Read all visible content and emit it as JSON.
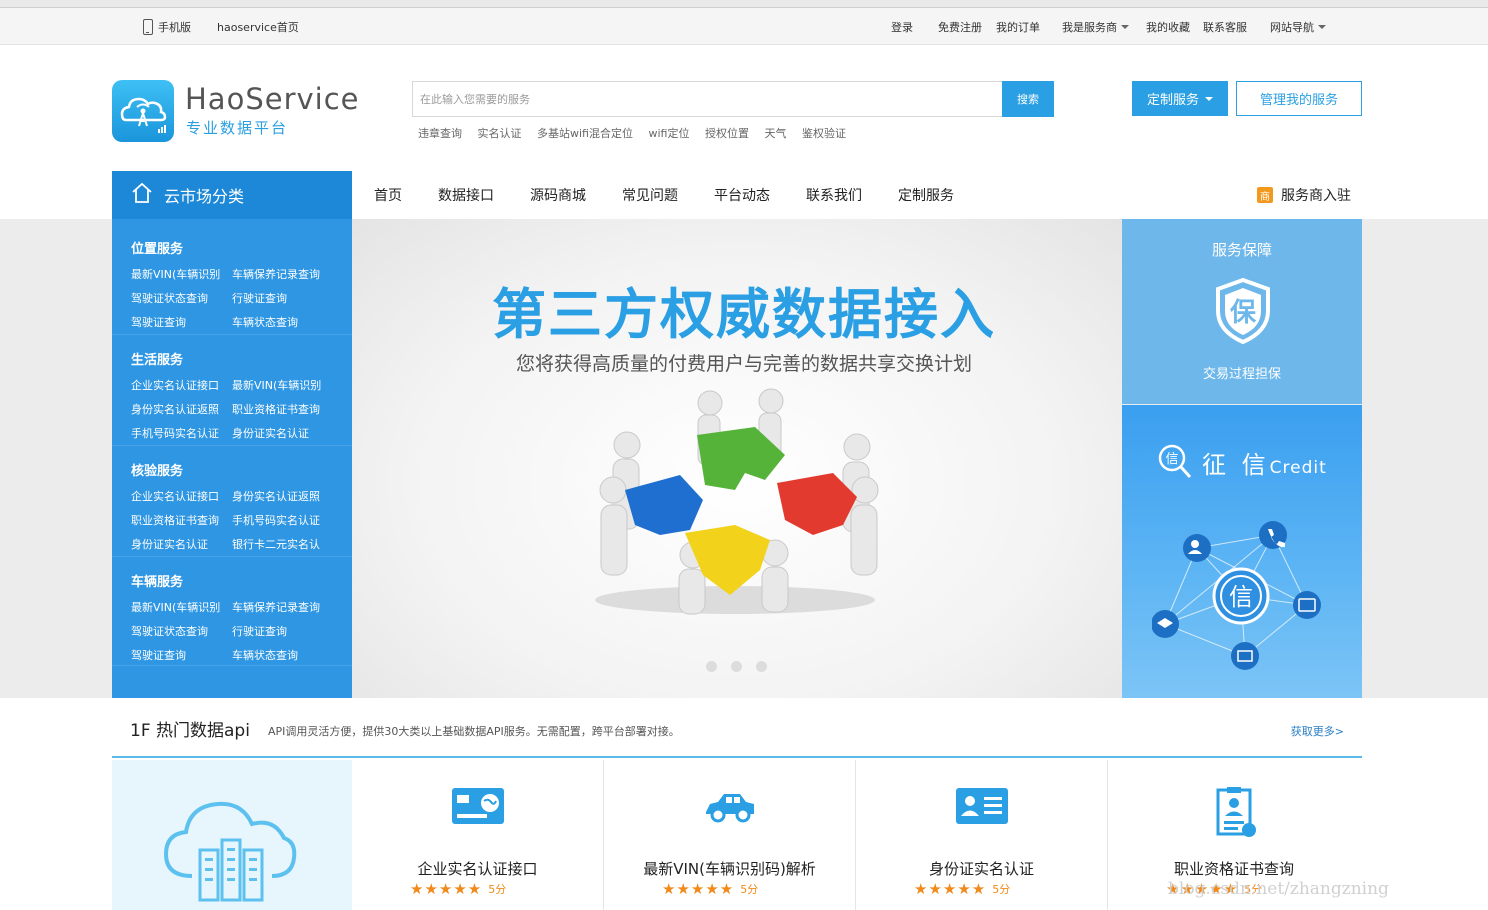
{
  "topbar": {
    "mobile": "手机版",
    "home": "haoservice首页",
    "login": "登录",
    "register": "免费注册",
    "orders": "我的订单",
    "provider": "我是服务商",
    "favorites": "我的收藏",
    "support": "联系客服",
    "sitenav": "网站导航"
  },
  "logo": {
    "title": "HaoService",
    "subtitle": "专业数据平台"
  },
  "search": {
    "placeholder": "在此输入您需要的服务",
    "button": "搜索",
    "hot_links": [
      "违章查询",
      "实名认证",
      "多基站wifi混合定位",
      "wifi定位",
      "授权位置",
      "天气",
      "鉴权验证"
    ]
  },
  "header_buttons": {
    "custom": "定制服务",
    "manage": "管理我的服务"
  },
  "category": {
    "title": "云市场分类"
  },
  "nav": [
    "首页",
    "数据接口",
    "源码商城",
    "常见问题",
    "平台动态",
    "联系我们",
    "定制服务"
  ],
  "merchant": {
    "badge": "商",
    "label": "服务商入驻"
  },
  "sidebar": [
    {
      "title": "位置服务",
      "items": [
        "最新VIN(车辆识别",
        "车辆保养记录查询",
        "驾驶证状态查询",
        "行驶证查询",
        "驾驶证查询",
        "车辆状态查询"
      ]
    },
    {
      "title": "生活服务",
      "items": [
        "企业实名认证接口",
        "最新VIN(车辆识别",
        "身份实名认证返照",
        "职业资格证书查询",
        "手机号码实名认证",
        "身份证实名认证"
      ]
    },
    {
      "title": "核验服务",
      "items": [
        "企业实名认证接口",
        "身份实名认证返照",
        "职业资格证书查询",
        "手机号码实名认证",
        "身份证实名认证",
        "银行卡二元实名认"
      ]
    },
    {
      "title": "车辆服务",
      "items": [
        "最新VIN(车辆识别",
        "车辆保养记录查询",
        "驾驶证状态查询",
        "行驶证查询",
        "驾驶证查询",
        "车辆状态查询"
      ]
    }
  ],
  "banner": {
    "title": "第三方权威数据接入",
    "subtitle": "您将获得高质量的付费用户与完善的数据共享交换计划"
  },
  "right_panel": {
    "guarantee_title": "服务保障",
    "guarantee_icon_text": "保",
    "guarantee_desc": "交易过程担保",
    "credit_cn": "征 信",
    "credit_en": "Credit",
    "credit_center": "信"
  },
  "hot_section": {
    "title": "1F 热门数据api",
    "desc": "API调用灵活方便，提供30大类以上基础数据API服务。无需配置，跨平台部署对接。",
    "more": "获取更多>"
  },
  "cards": [
    {
      "name": "企业实名认证接口",
      "score": "5分",
      "icon": "business-card-icon"
    },
    {
      "name": "最新VIN(车辆识别码)解析",
      "score": "5分",
      "icon": "car-icon"
    },
    {
      "name": "身份证实名认证",
      "score": "5分",
      "icon": "id-card-icon"
    },
    {
      "name": "职业资格证书查询",
      "score": "5分",
      "icon": "certificate-icon"
    }
  ],
  "stars": "★★★★★",
  "watermark": "blog.csdn.net/zhangzning",
  "colors": {
    "brand_blue": "#2a9fe3",
    "sidebar_blue": "#2e96e3",
    "star_orange": "#f08a1b"
  }
}
